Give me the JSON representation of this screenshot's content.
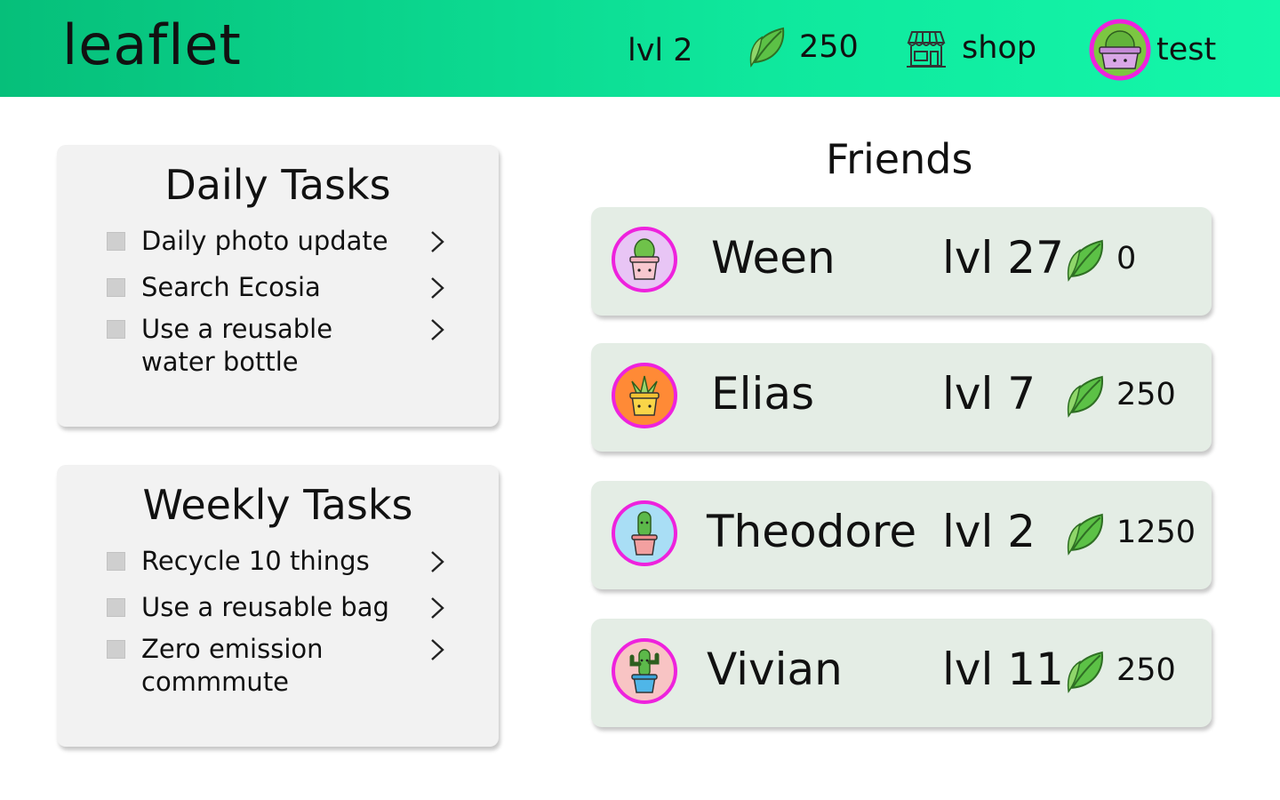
{
  "header": {
    "app_title": "leaflet",
    "level": "lvl 2",
    "points": "250",
    "shop_label": "shop",
    "username": "test",
    "gradient_colors": [
      "#06bf7a",
      "#14f7aa"
    ]
  },
  "daily": {
    "title": "Daily Tasks",
    "tasks": [
      {
        "label": "Daily photo update"
      },
      {
        "label": "Search Ecosia"
      },
      {
        "label": "Use a reusable water bottle"
      }
    ]
  },
  "weekly": {
    "title": "Weekly Tasks",
    "tasks": [
      {
        "label": "Recycle 10 things"
      },
      {
        "label": "Use a reusable bag"
      },
      {
        "label": "Zero emission commmute"
      }
    ]
  },
  "friends": {
    "title": "Friends",
    "list": [
      {
        "name": "Ween",
        "level": "lvl 27",
        "points": "0",
        "avatar_bg": "#e8c5f5",
        "pot_color": "#f8c8cf",
        "plant": "cactus-round"
      },
      {
        "name": "Elias",
        "level": "lvl 7",
        "points": "250",
        "avatar_bg": "#ff8a36",
        "pot_color": "#f9d548",
        "plant": "succulent"
      },
      {
        "name": "Theodore",
        "level": "lvl 2",
        "points": "1250",
        "avatar_bg": "#a9def5",
        "pot_color": "#f3a0a0",
        "plant": "cactus-tall"
      },
      {
        "name": "Vivian",
        "level": "lvl 11",
        "points": "250",
        "avatar_bg": "#f8c4c4",
        "pot_color": "#4fb6e8",
        "plant": "cactus-arms"
      }
    ]
  },
  "colors": {
    "accent_pink": "#ee22dd",
    "card_green": "#e4ede5",
    "panel_gray": "#f2f2f2",
    "leaf_green": "#5cc146"
  }
}
